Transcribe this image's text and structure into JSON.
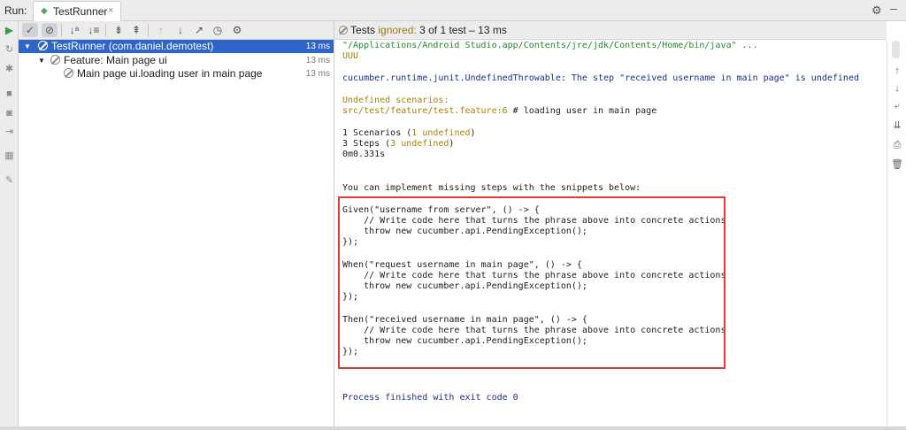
{
  "topbar": {
    "run_label": "Run:",
    "tab_label": "TestRunner",
    "tab_icon": "android-run-icon",
    "close_glyph": "×"
  },
  "left_toolbar": [
    "rerun-icon",
    "rerun-failed-icon",
    "debug-icon",
    "stop-icon",
    "camera-icon",
    "exit-icon",
    "layout-icon",
    "pin-icon"
  ],
  "tree_toolbar": [
    "show-passed-icon",
    "show-ignored-icon",
    "sort-alpha-icon",
    "sort-duration-icon",
    "expand-all-icon",
    "collapse-all-icon",
    "prev-failed-icon",
    "next-failed-icon",
    "export-icon",
    "history-icon",
    "settings-icon"
  ],
  "tree": {
    "rows": [
      {
        "label": "TestRunner (com.daniel.demotest)",
        "time": "13 ms"
      },
      {
        "label": "Feature: Main page ui",
        "time": "13 ms"
      },
      {
        "label": "Main page ui.loading user in main page",
        "time": "13 ms"
      }
    ]
  },
  "status": {
    "prefix": "Tests",
    "ignored": "ignored:",
    "count": "3",
    "rest": "of 1 test – 13 ms"
  },
  "console": {
    "cmd": "\"/Applications/Android Studio.app/Contents/jre/jdk/Contents/Home/bin/java\" ...",
    "uuu": "UUU",
    "error": "cucumber.runtime.junit.UndefinedThrowable: The step \"received username in main page\" is undefined",
    "undef_title": "Undefined scenarios:",
    "undef_file": "src/test/feature/test.feature:6",
    "undef_comment": " # loading user in main page",
    "scenarios_a": "1 Scenarios (",
    "scenarios_b": "1 undefined",
    "scenarios_c": ")",
    "steps_a": "3 Steps (",
    "steps_b": "3 undefined",
    "steps_c": ")",
    "time": "0m0.331s",
    "snippets_intro": "You can implement missing steps with the snippets below:",
    "given": "Given(\"username from server\", () -> {",
    "when": "When(\"request username in main page\", () -> {",
    "then": "Then(\"received username in main page\", () -> {",
    "comment": "    // Write code here that turns the phrase above into concrete actions",
    "throw": "    throw new cucumber.api.PendingException();",
    "close": "});",
    "exit": "Process finished with exit code 0"
  },
  "right_toolbar": [
    "up-icon",
    "down-icon",
    "soft-wrap-icon",
    "scroll-to-end-icon",
    "print-icon",
    "trash-icon"
  ],
  "colors": {
    "selected": "#2f65ca",
    "highlight_box": "#e03a3a",
    "ignored": "#9a7d0a",
    "console_green": "#248a2e",
    "console_blue": "#1c2d8f"
  }
}
